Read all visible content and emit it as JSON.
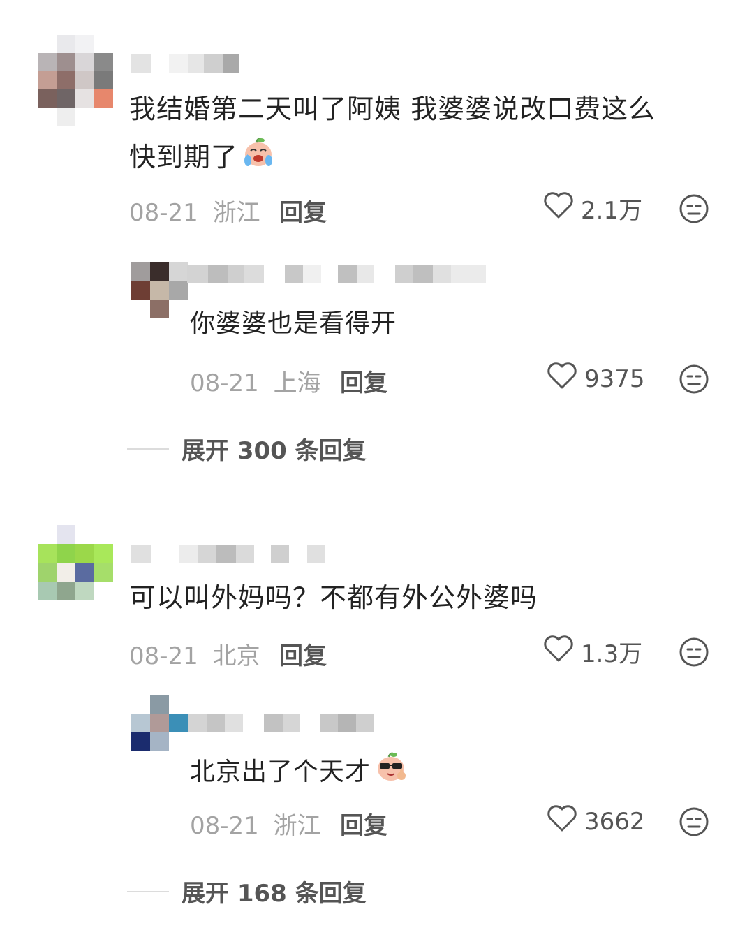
{
  "comments": [
    {
      "text_lines": [
        "我结婚第二天叫了阿姨  我婆婆说改口费这么",
        "快到期了"
      ],
      "emoji": "crying-face-emoji",
      "date": "08-21",
      "location": "浙江",
      "reply_label": "回复",
      "likes": "2.1万",
      "reply": {
        "text": "你婆婆也是看得开",
        "date": "08-21",
        "location": "上海",
        "reply_label": "回复",
        "likes": "9375"
      },
      "expand_label": "展开 300 条回复"
    },
    {
      "text_lines": [
        "可以叫外妈吗？不都有外公外婆吗"
      ],
      "date": "08-21",
      "location": "北京",
      "reply_label": "回复",
      "likes": "1.3万",
      "reply": {
        "text": "北京出了个天才",
        "emoji": "sunglasses-thumbs-up-emoji",
        "date": "08-21",
        "location": "浙江",
        "reply_label": "回复",
        "likes": "3662"
      },
      "expand_label": "展开 168 条回复"
    }
  ],
  "icons": {
    "like": "heart-outline-icon",
    "dislike": "neutral-face-icon"
  },
  "colors": {
    "text": "#222222",
    "meta": "#a3a3a3",
    "action": "#555555"
  }
}
